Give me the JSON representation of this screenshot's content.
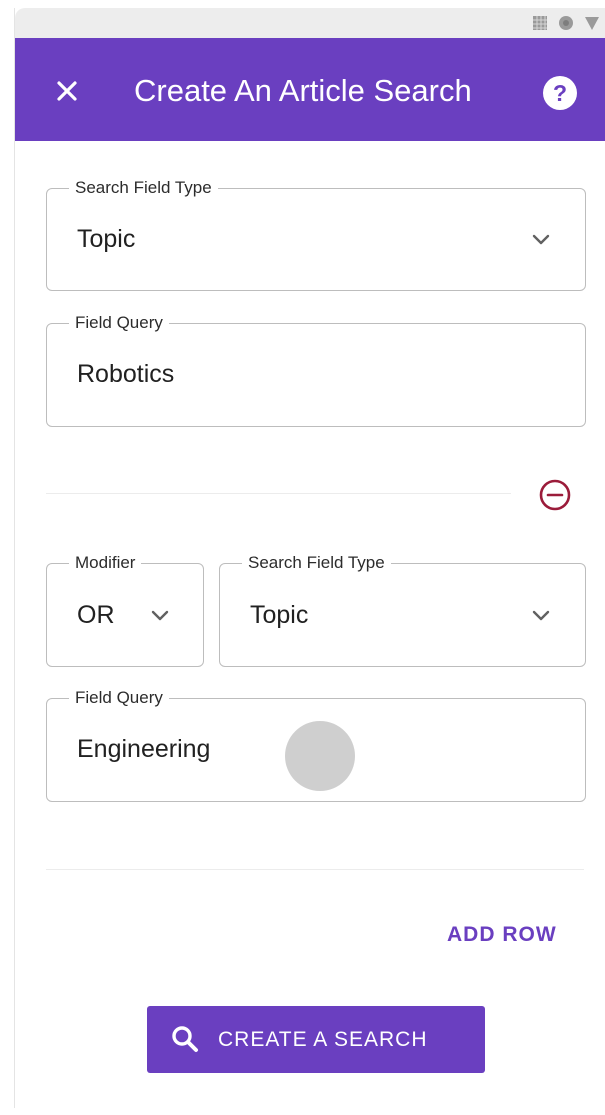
{
  "status_bar": {
    "icons": [
      "signal-grid-icon",
      "wifi-dot-icon",
      "battery-triangle-icon"
    ]
  },
  "app_bar": {
    "title": "Create An Article Search",
    "close_icon": "close-icon",
    "help_label": "?",
    "background_color": "#6a3fc0"
  },
  "row1": {
    "search_field_type": {
      "label": "Search Field Type",
      "value": "Topic"
    },
    "field_query": {
      "label": "Field Query",
      "value": "Robotics"
    }
  },
  "row2": {
    "modifier": {
      "label": "Modifier",
      "value": "OR"
    },
    "search_field_type": {
      "label": "Search Field Type",
      "value": "Topic"
    },
    "field_query": {
      "label": "Field Query",
      "value": "Engineering"
    }
  },
  "actions": {
    "add_row": "ADD ROW",
    "create_search": "CREATE A SEARCH",
    "accent_color": "#6a3fc0",
    "remove_color": "#9b1c3a"
  }
}
